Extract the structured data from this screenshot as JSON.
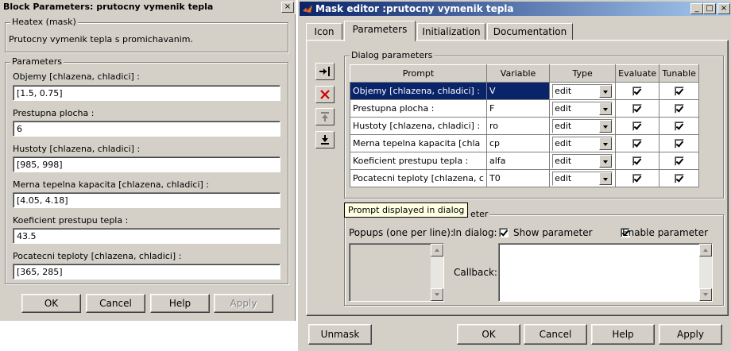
{
  "block_dialog": {
    "title": "Block Parameters: prutocny vymenik tepla",
    "close_glyph": "×",
    "group_desc_label": "Heatex (mask)",
    "description": "Prutocny vymenik tepla s promichavanim.",
    "group_params_label": "Parameters",
    "params": [
      {
        "label": "Objemy  [chlazena, chladici] :",
        "value": "[1.5, 0.75]"
      },
      {
        "label": "Prestupna plocha :",
        "value": "6"
      },
      {
        "label": "Hustoty [chlazena, chladici] :",
        "value": "[985, 998]"
      },
      {
        "label": "Merna tepelna kapacita [chlazena, chladici] :",
        "value": "[4.05, 4.18]"
      },
      {
        "label": "Koeficient prestupu tepla :",
        "value": "43.5"
      },
      {
        "label": "Pocatecni teploty [chlazena, chladici] :",
        "value": "[365, 285]"
      }
    ],
    "buttons": {
      "ok": "OK",
      "cancel": "Cancel",
      "help": "Help",
      "apply": "Apply"
    }
  },
  "mask_editor": {
    "title": "Mask editor :prutocny vymenik tepla",
    "tabs": [
      "Icon",
      "Parameters",
      "Initialization",
      "Documentation"
    ],
    "active_tab": "Parameters",
    "dialog_params_label": "Dialog parameters",
    "columns": [
      "Prompt",
      "Variable",
      "Type",
      "Evaluate",
      "Tunable"
    ],
    "rows": [
      {
        "prompt": "Objemy  [chlazena, chladici] :",
        "variable": "V",
        "type": "edit",
        "evaluate": true,
        "tunable": true
      },
      {
        "prompt": "Prestupna plocha :",
        "variable": "F",
        "type": "edit",
        "evaluate": true,
        "tunable": true
      },
      {
        "prompt": "Hustoty [chlazena, chladici] :",
        "variable": "ro",
        "type": "edit",
        "evaluate": true,
        "tunable": true
      },
      {
        "prompt": "Merna tepelna kapacita [chla",
        "variable": "cp",
        "type": "edit",
        "evaluate": true,
        "tunable": true
      },
      {
        "prompt": "Koeficient prestupu tepla :",
        "variable": "alfa",
        "type": "edit",
        "evaluate": true,
        "tunable": true
      },
      {
        "prompt": "Pocatecni teploty [chlazena, c",
        "variable": "T0",
        "type": "edit",
        "evaluate": true,
        "tunable": true
      }
    ],
    "tooltip": "Prompt displayed in dialog",
    "options_group_label_tail": "eter",
    "popups_label": "Popups (one per line):",
    "in_dialog_label": "In dialog:",
    "show_parameter_label": "Show parameter",
    "enable_parameter_label": "Enable parameter",
    "callback_label": "Callback:",
    "buttons": {
      "unmask": "Unmask",
      "ok": "OK",
      "cancel": "Cancel",
      "help": "Help",
      "apply": "Apply"
    },
    "window_controls": {
      "minimize": "_",
      "maximize": "□",
      "close": "×"
    }
  },
  "colors": {
    "titlebar_active": "#0a246a",
    "selection": "#0a246a",
    "face": "#d4d0c8"
  },
  "icons": [
    "matlab-logo-icon",
    "add-parameter-icon",
    "delete-parameter-icon",
    "move-up-icon",
    "move-down-icon"
  ]
}
